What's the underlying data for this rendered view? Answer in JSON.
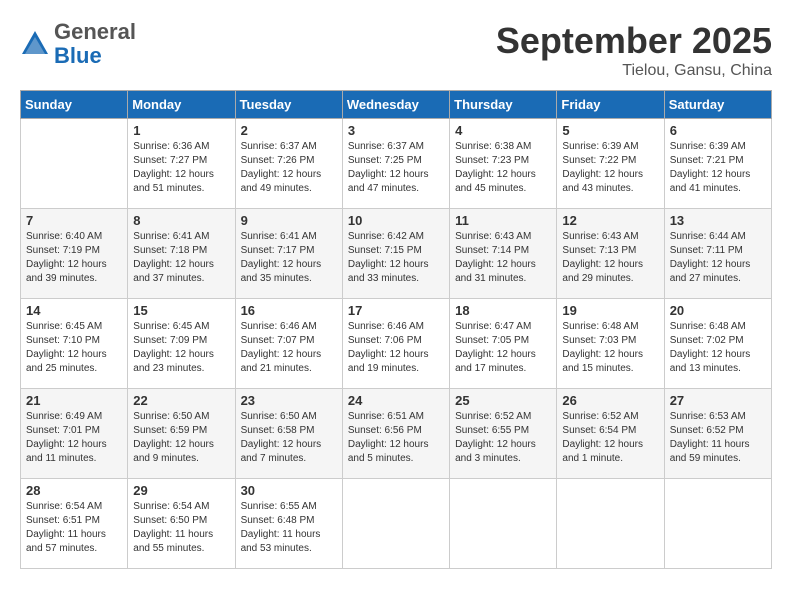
{
  "header": {
    "logo_general": "General",
    "logo_blue": "Blue",
    "month_title": "September 2025",
    "location": "Tielou, Gansu, China"
  },
  "weekdays": [
    "Sunday",
    "Monday",
    "Tuesday",
    "Wednesday",
    "Thursday",
    "Friday",
    "Saturday"
  ],
  "weeks": [
    [
      {
        "day": "",
        "empty": true
      },
      {
        "day": "1",
        "sunrise": "6:36 AM",
        "sunset": "7:27 PM",
        "daylight": "12 hours and 51 minutes."
      },
      {
        "day": "2",
        "sunrise": "6:37 AM",
        "sunset": "7:26 PM",
        "daylight": "12 hours and 49 minutes."
      },
      {
        "day": "3",
        "sunrise": "6:37 AM",
        "sunset": "7:25 PM",
        "daylight": "12 hours and 47 minutes."
      },
      {
        "day": "4",
        "sunrise": "6:38 AM",
        "sunset": "7:23 PM",
        "daylight": "12 hours and 45 minutes."
      },
      {
        "day": "5",
        "sunrise": "6:39 AM",
        "sunset": "7:22 PM",
        "daylight": "12 hours and 43 minutes."
      },
      {
        "day": "6",
        "sunrise": "6:39 AM",
        "sunset": "7:21 PM",
        "daylight": "12 hours and 41 minutes."
      }
    ],
    [
      {
        "day": "7",
        "sunrise": "6:40 AM",
        "sunset": "7:19 PM",
        "daylight": "12 hours and 39 minutes."
      },
      {
        "day": "8",
        "sunrise": "6:41 AM",
        "sunset": "7:18 PM",
        "daylight": "12 hours and 37 minutes."
      },
      {
        "day": "9",
        "sunrise": "6:41 AM",
        "sunset": "7:17 PM",
        "daylight": "12 hours and 35 minutes."
      },
      {
        "day": "10",
        "sunrise": "6:42 AM",
        "sunset": "7:15 PM",
        "daylight": "12 hours and 33 minutes."
      },
      {
        "day": "11",
        "sunrise": "6:43 AM",
        "sunset": "7:14 PM",
        "daylight": "12 hours and 31 minutes."
      },
      {
        "day": "12",
        "sunrise": "6:43 AM",
        "sunset": "7:13 PM",
        "daylight": "12 hours and 29 minutes."
      },
      {
        "day": "13",
        "sunrise": "6:44 AM",
        "sunset": "7:11 PM",
        "daylight": "12 hours and 27 minutes."
      }
    ],
    [
      {
        "day": "14",
        "sunrise": "6:45 AM",
        "sunset": "7:10 PM",
        "daylight": "12 hours and 25 minutes."
      },
      {
        "day": "15",
        "sunrise": "6:45 AM",
        "sunset": "7:09 PM",
        "daylight": "12 hours and 23 minutes."
      },
      {
        "day": "16",
        "sunrise": "6:46 AM",
        "sunset": "7:07 PM",
        "daylight": "12 hours and 21 minutes."
      },
      {
        "day": "17",
        "sunrise": "6:46 AM",
        "sunset": "7:06 PM",
        "daylight": "12 hours and 19 minutes."
      },
      {
        "day": "18",
        "sunrise": "6:47 AM",
        "sunset": "7:05 PM",
        "daylight": "12 hours and 17 minutes."
      },
      {
        "day": "19",
        "sunrise": "6:48 AM",
        "sunset": "7:03 PM",
        "daylight": "12 hours and 15 minutes."
      },
      {
        "day": "20",
        "sunrise": "6:48 AM",
        "sunset": "7:02 PM",
        "daylight": "12 hours and 13 minutes."
      }
    ],
    [
      {
        "day": "21",
        "sunrise": "6:49 AM",
        "sunset": "7:01 PM",
        "daylight": "12 hours and 11 minutes."
      },
      {
        "day": "22",
        "sunrise": "6:50 AM",
        "sunset": "6:59 PM",
        "daylight": "12 hours and 9 minutes."
      },
      {
        "day": "23",
        "sunrise": "6:50 AM",
        "sunset": "6:58 PM",
        "daylight": "12 hours and 7 minutes."
      },
      {
        "day": "24",
        "sunrise": "6:51 AM",
        "sunset": "6:56 PM",
        "daylight": "12 hours and 5 minutes."
      },
      {
        "day": "25",
        "sunrise": "6:52 AM",
        "sunset": "6:55 PM",
        "daylight": "12 hours and 3 minutes."
      },
      {
        "day": "26",
        "sunrise": "6:52 AM",
        "sunset": "6:54 PM",
        "daylight": "12 hours and 1 minute."
      },
      {
        "day": "27",
        "sunrise": "6:53 AM",
        "sunset": "6:52 PM",
        "daylight": "11 hours and 59 minutes."
      }
    ],
    [
      {
        "day": "28",
        "sunrise": "6:54 AM",
        "sunset": "6:51 PM",
        "daylight": "11 hours and 57 minutes."
      },
      {
        "day": "29",
        "sunrise": "6:54 AM",
        "sunset": "6:50 PM",
        "daylight": "11 hours and 55 minutes."
      },
      {
        "day": "30",
        "sunrise": "6:55 AM",
        "sunset": "6:48 PM",
        "daylight": "11 hours and 53 minutes."
      },
      {
        "day": "",
        "empty": true
      },
      {
        "day": "",
        "empty": true
      },
      {
        "day": "",
        "empty": true
      },
      {
        "day": "",
        "empty": true
      }
    ]
  ]
}
